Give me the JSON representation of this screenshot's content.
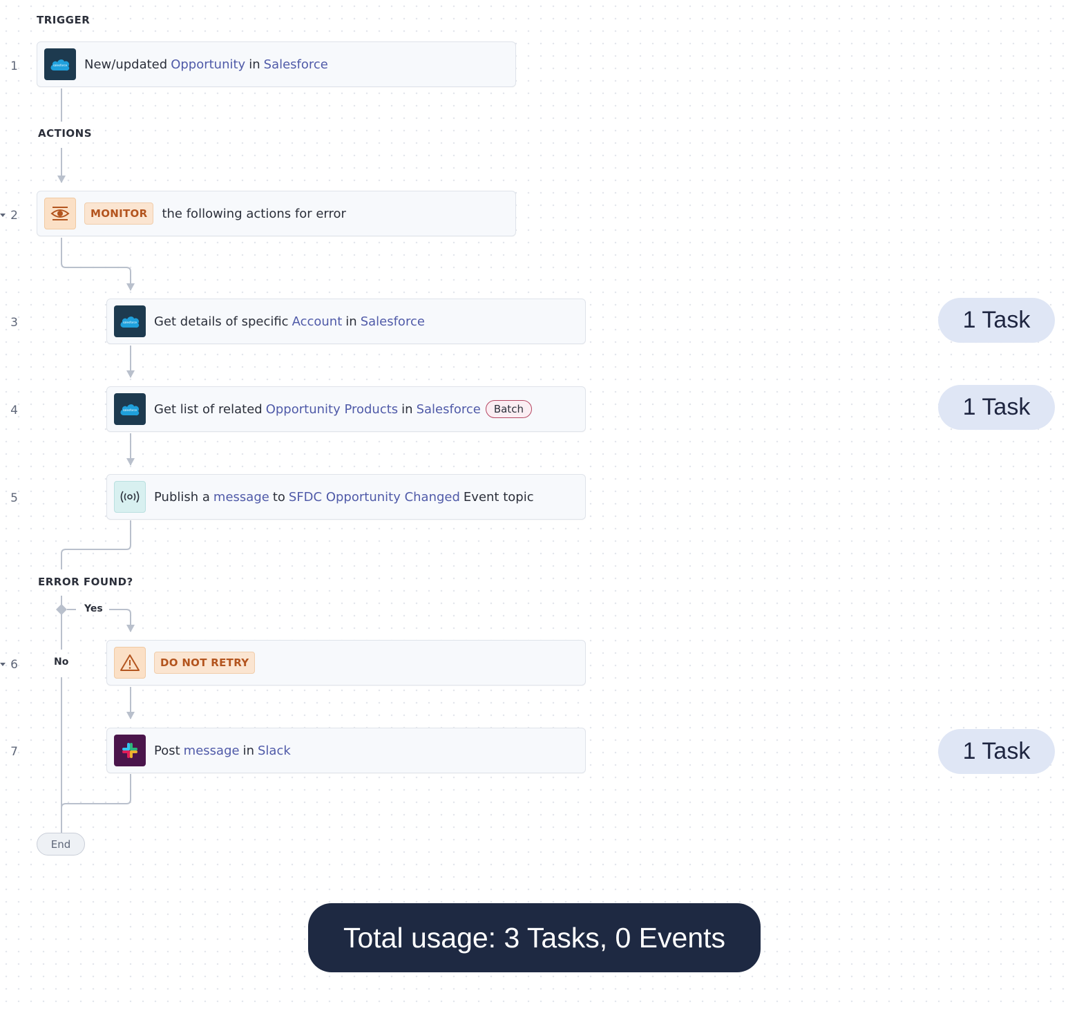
{
  "sections": {
    "trigger": "TRIGGER",
    "actions": "ACTIONS",
    "error_found": "ERROR FOUND?"
  },
  "steps": [
    {
      "num": "1",
      "icon": "salesforce-icon",
      "parts": [
        "New/updated",
        "Opportunity",
        "in",
        "Salesforce"
      ]
    },
    {
      "num": "2",
      "icon": "monitor-eye-icon",
      "keyword": "MONITOR",
      "text": "the following actions for error"
    },
    {
      "num": "3",
      "icon": "salesforce-icon",
      "parts": [
        "Get details of specific",
        "Account",
        "in",
        "Salesforce"
      ]
    },
    {
      "num": "4",
      "icon": "salesforce-icon",
      "parts": [
        "Get list of related",
        "Opportunity Products",
        "in",
        "Salesforce"
      ],
      "badge": "Batch"
    },
    {
      "num": "5",
      "icon": "event-stream-icon",
      "parts": [
        "Publish a",
        "message",
        "to",
        "SFDC Opportunity Changed",
        "Event topic"
      ]
    },
    {
      "num": "6",
      "icon": "warning-icon",
      "keyword": "DO NOT RETRY"
    },
    {
      "num": "7",
      "icon": "slack-icon",
      "parts": [
        "Post",
        "message",
        "in",
        "Slack"
      ]
    }
  ],
  "branches": {
    "yes": "Yes",
    "no": "No"
  },
  "end_label": "End",
  "task_badges": [
    "1 Task",
    "1 Task",
    "1 Task"
  ],
  "total_usage": "Total usage: 3 Tasks, 0 Events",
  "colors": {
    "link": "#4f5aa8",
    "keyword": "#b3541e",
    "salesforce_tile": "#1d3a4f",
    "slack_tile": "#4a154b",
    "total_banner": "#1e2942",
    "task_pill": "#dfe6f5"
  }
}
